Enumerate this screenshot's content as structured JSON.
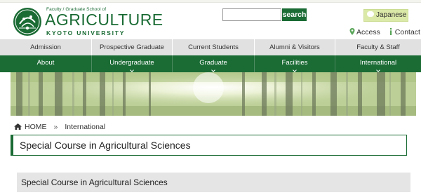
{
  "header": {
    "logo_small_text": "Faculty / Graduate School of",
    "logo_main_text": "AGRICULTURE",
    "logo_university_text": "KYOTO UNIVERSITY",
    "search_placeholder": "",
    "search_button": "search",
    "language_button": "Japanese",
    "access_link": "Access",
    "contact_link": "Contact"
  },
  "nav_gray": [
    "Admission",
    "Prospective Graduate",
    "Current Students",
    "Alumni & Visitors",
    "Faculty & Staff"
  ],
  "nav_green": [
    "About",
    "Undergraduate",
    "Graduate",
    "Facilities",
    "International"
  ],
  "breadcrumb": {
    "home": "HOME",
    "separator": "»",
    "current": "International"
  },
  "page_title": "Special Course in Agricultural Sciences",
  "section_heading": "Special Course in Agricultural Sciences",
  "colors": {
    "brand_green": "#1a6b34",
    "nav_gray": "#e1e1e1",
    "language_button": "#dbe9a8"
  }
}
